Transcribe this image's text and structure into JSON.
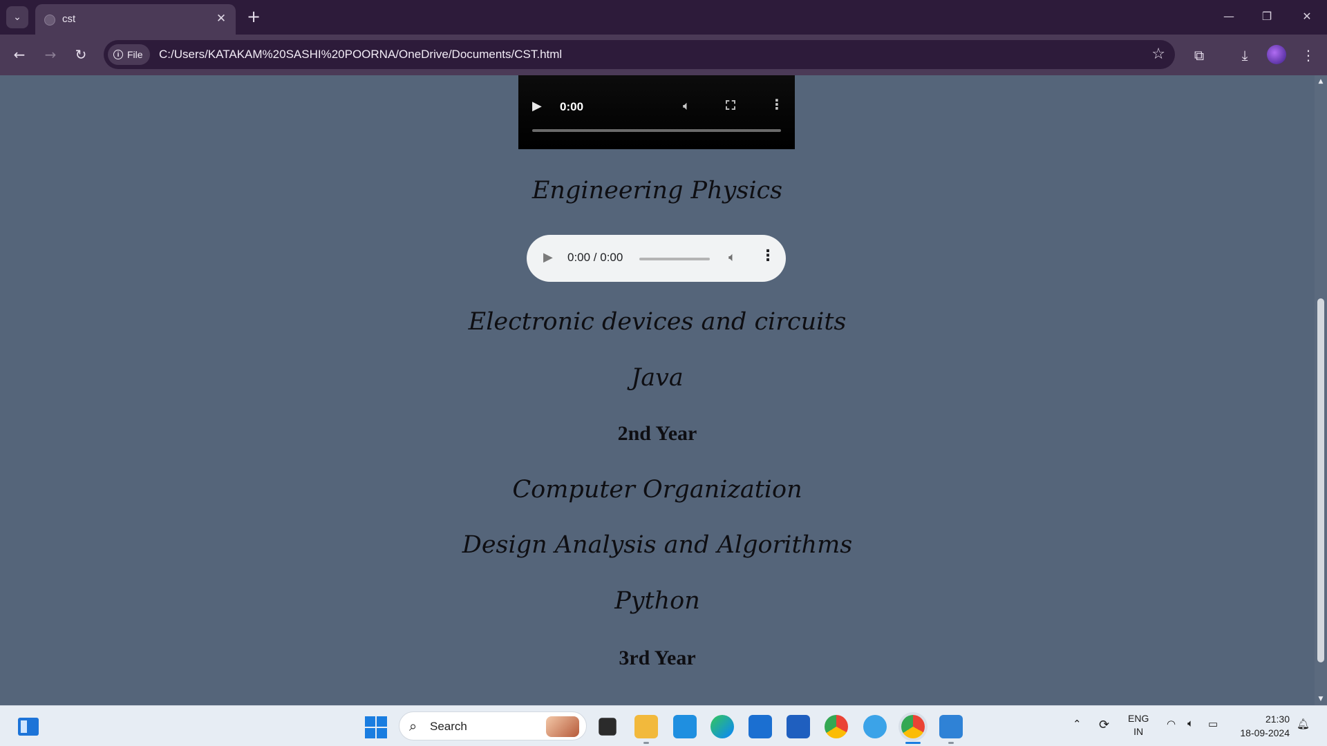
{
  "browser": {
    "tab_title": "cst",
    "tab_close": "✕",
    "new_tab": "+",
    "chip_label": "File",
    "url": "C:/Users/KATAKAM%20SASHI%20POORNA/OneDrive/Documents/CST.html"
  },
  "page": {
    "video": {
      "time": "0:00"
    },
    "audio": {
      "time": "0:00 / 0:00"
    },
    "subjects_1": [
      "Engineering Physics",
      "Electronic devices and circuits",
      "Java"
    ],
    "year_2": "2nd Year",
    "subjects_2": [
      "Computer Organization",
      "Design Analysis and Algorithms",
      "Python"
    ],
    "year_3": "3rd Year"
  },
  "taskbar": {
    "search_label": "Search",
    "language": [
      "ENG",
      "IN"
    ],
    "time": "21:30",
    "date": "18-09-2024"
  },
  "colors": {
    "page_background": "#55657a",
    "browser_frame": "#2d1b3a",
    "toolbar": "#4b3a57",
    "taskbar": "#e7edf4"
  },
  "icons": [
    "tab-list-icon",
    "globe-icon",
    "close-icon",
    "plus-icon",
    "minimize-icon",
    "restore-icon",
    "back-icon",
    "forward-icon",
    "reload-icon",
    "info-icon",
    "star-icon",
    "extensions-icon",
    "download-icon",
    "profile-icon",
    "play-icon",
    "volume-icon",
    "fullscreen-icon",
    "more-icon",
    "windows-start-icon",
    "search-icon"
  ]
}
